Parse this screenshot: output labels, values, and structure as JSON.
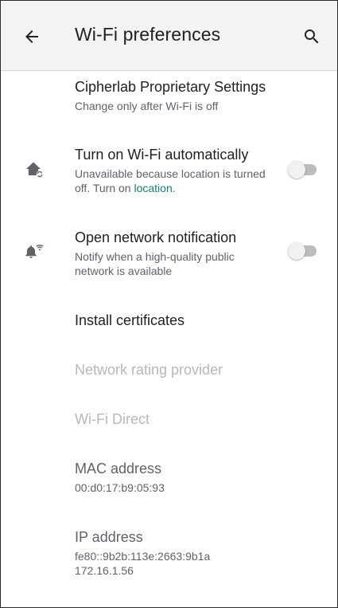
{
  "app_bar": {
    "title": "Wi-Fi preferences",
    "back_icon": "arrow-back-icon",
    "search_icon": "search-icon"
  },
  "items": {
    "cipherlab": {
      "title": "Cipherlab Proprietary Settings",
      "summary": "Change only after Wi-Fi is off"
    },
    "wifi_auto": {
      "icon": "home-wifi-auto-icon",
      "title": "Turn on Wi-Fi automatically",
      "summary_before": "Unavailable because location is turned off. Turn on ",
      "summary_link": "location",
      "summary_after": ".",
      "toggle_on": false
    },
    "open_network": {
      "icon": "notification-wifi-icon",
      "title": "Open network notification",
      "summary": "Notify when a high-quality public network is available",
      "toggle_on": false
    },
    "install_certs": {
      "title": "Install certificates"
    },
    "network_rating": {
      "title": "Network rating provider",
      "enabled": false
    },
    "wifi_direct": {
      "title": "Wi-Fi Direct",
      "enabled": false
    },
    "mac": {
      "title": "MAC address",
      "value": "00:d0:17:b9:05:93"
    },
    "ip": {
      "title": "IP address",
      "value_line1": "fe80::9b2b:113e:2663:9b1a",
      "value_line2": "172.16.1.56"
    }
  },
  "colors": {
    "link": "#1a7f72",
    "toggle_track_off": "#bdbdbd",
    "toggle_thumb_off": "#f1f1f1",
    "disabled_text": "#b8b8b8",
    "app_bar_bg": "#f3f3f3"
  }
}
